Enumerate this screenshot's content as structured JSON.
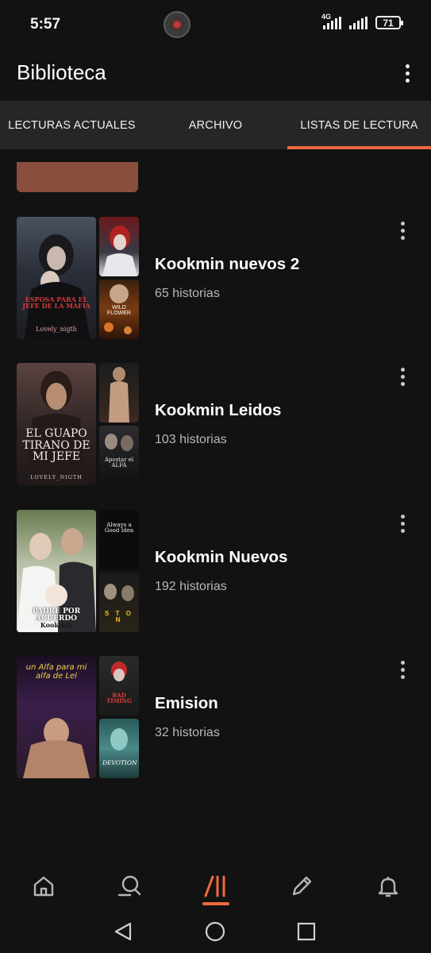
{
  "status_bar": {
    "time": "5:57",
    "network": "4G",
    "battery": "71"
  },
  "header": {
    "title": "Biblioteca",
    "menu_icon": "more-vertical-icon"
  },
  "tabs": [
    {
      "label": "LECTURAS ACTUALES",
      "active": false
    },
    {
      "label": "ARCHIVO",
      "active": false
    },
    {
      "label": "LISTAS DE LECTURA",
      "active": true
    }
  ],
  "reading_lists": [
    {
      "title": "Kookmin nuevos 2",
      "count": "65 historias",
      "covers": {
        "main_text": "ESPOSA PARA EL JEFE DE LA MAFIA",
        "main_author": "Lovely_nigth",
        "small2_text": "WILD FLOWER"
      }
    },
    {
      "title": "Kookmin Leidos",
      "count": "103 historias",
      "covers": {
        "main_text": "EL GUAPO TIRANO DE MI JEFE",
        "main_author": "LOVELY_NIGTH",
        "small2_text": "Apostar el ALFA"
      }
    },
    {
      "title": "Kookmin Nuevos",
      "count": "192 historias",
      "covers": {
        "main_text": "PADRE POR ACUERDO",
        "main_author": "Kookmin",
        "small1_text": "Always a Good Idea",
        "small2_text": "S T O N"
      }
    },
    {
      "title": "Emision",
      "count": "32 historias",
      "covers": {
        "main_text": "un Alfa para mi alfa de Lel",
        "small1_text": "BAD TIMING",
        "small2_text": "DEVOTION"
      }
    }
  ],
  "bottom_nav": [
    {
      "icon": "home-icon"
    },
    {
      "icon": "search-icon"
    },
    {
      "icon": "library-icon",
      "active": true
    },
    {
      "icon": "pencil-icon"
    },
    {
      "icon": "bell-icon"
    }
  ],
  "colors": {
    "accent": "#ee6a3f",
    "background": "#121212",
    "tab_bar": "#262626"
  }
}
